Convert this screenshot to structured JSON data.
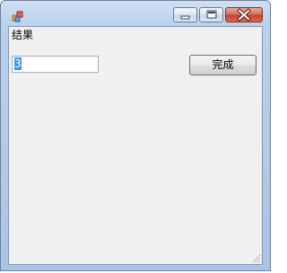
{
  "window": {
    "title": "",
    "icon": "app-window-icon",
    "controls": [
      "minimize-icon",
      "maximize-icon",
      "close-icon"
    ]
  },
  "form": {
    "result_label": "结果",
    "input_value": "3",
    "done_button_label": "完成"
  }
}
